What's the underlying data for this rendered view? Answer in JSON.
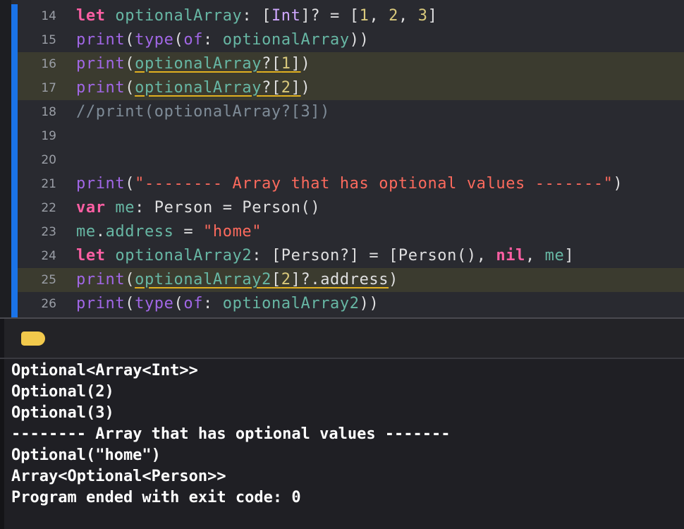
{
  "editor": {
    "lines": [
      {
        "num": "14",
        "text": "let optionalArray: [Int]? = [1, 2, 3]"
      },
      {
        "num": "15",
        "text": "print(type(of: optionalArray))"
      },
      {
        "num": "16",
        "text": "print(optionalArray?[1])"
      },
      {
        "num": "17",
        "text": "print(optionalArray?[2])"
      },
      {
        "num": "18",
        "text": "//print(optionalArray?[3])"
      },
      {
        "num": "19",
        "text": ""
      },
      {
        "num": "20",
        "text": ""
      },
      {
        "num": "21",
        "text": "print(\"-------- Array that has optional values -------\")"
      },
      {
        "num": "22",
        "text": "var me: Person = Person()"
      },
      {
        "num": "23",
        "text": "me.address = \"home\""
      },
      {
        "num": "24",
        "text": "let optionalArray2: [Person?] = [Person(), nil, me]"
      },
      {
        "num": "25",
        "text": "print(optionalArray2[2]?.address)"
      },
      {
        "num": "26",
        "text": "print(type(of: optionalArray2))"
      }
    ]
  },
  "console": {
    "output": [
      "Optional<Array<Int>>",
      "Optional(2)",
      "Optional(3)",
      "-------- Array that has optional values -------",
      "Optional(\"home\")",
      "Array<Optional<Person>>",
      "Program ended with exit code: 0"
    ]
  },
  "colors": {
    "keyword": "#fc5fa3",
    "function": "#a167e6",
    "variable": "#67b7a4",
    "type": "#d0a8ff",
    "number": "#d9c97c",
    "string": "#fc6a5d",
    "comment": "#7f8c98",
    "breakpoint_tag": "#f2c94c",
    "change_bar": "#1a73e8"
  },
  "icons": {
    "console_tag": "breakpoint-tag-icon"
  }
}
